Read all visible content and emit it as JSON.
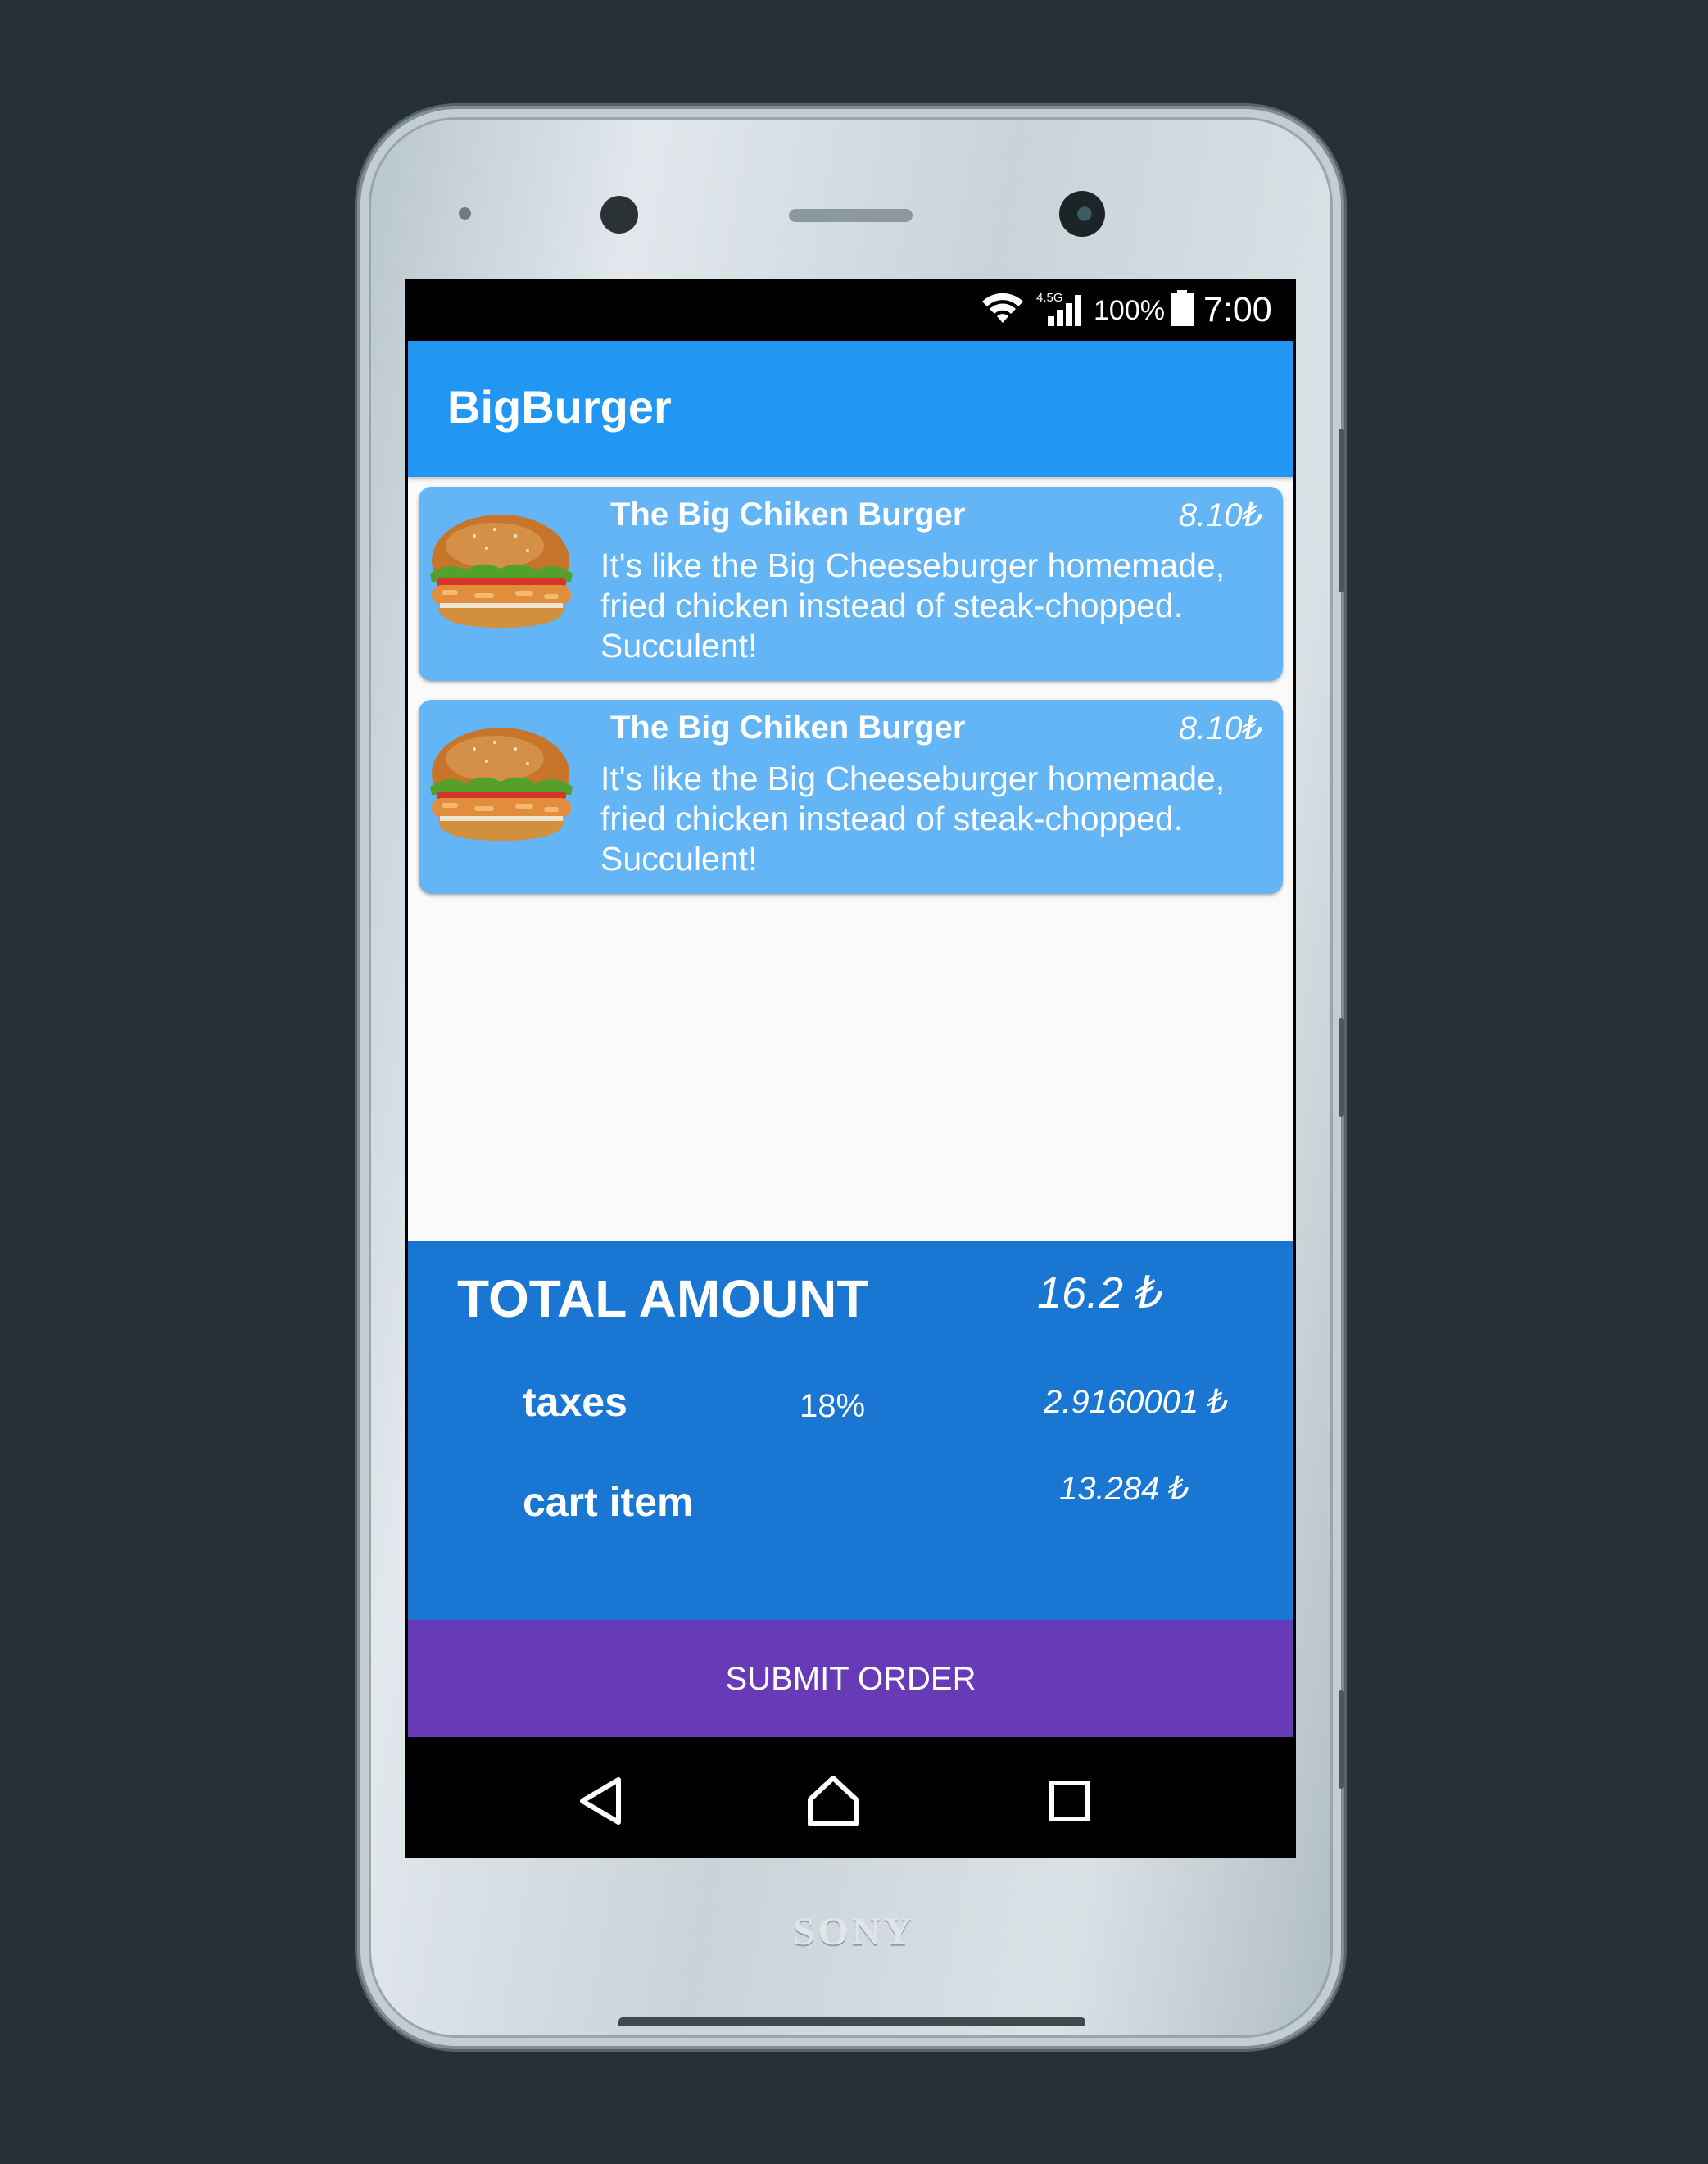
{
  "device": {
    "brand": "SONY"
  },
  "status_bar": {
    "network": "4.5G",
    "battery_percent": "100%",
    "time": "7:00"
  },
  "app_bar": {
    "title": "BigBurger"
  },
  "cart_items": [
    {
      "title": "The Big Chiken Burger",
      "price": "8.10₺",
      "description": "It's like the Big Cheeseburger homemade, fried chicken instead of steak-chopped. Succulent!"
    },
    {
      "title": "The Big Chiken Burger",
      "price": "8.10₺",
      "description": "It's like the Big Cheeseburger homemade, fried chicken instead of steak-chopped. Succulent!"
    }
  ],
  "summary": {
    "total_label": "TOTAL AMOUNT",
    "total_value": "16.2 ₺",
    "taxes_label": "taxes",
    "taxes_rate": "18%",
    "taxes_value": "2.9160001 ₺",
    "cart_label": "cart item",
    "cart_value": "13.284 ₺"
  },
  "submit_button": {
    "label": "SUBMIT ORDER"
  },
  "colors": {
    "background": "#263136",
    "app_bar": "#2196f3",
    "card": "#64b5f6",
    "summary": "#1976d2",
    "submit": "#673ab7"
  },
  "icons": [
    "wifi-icon",
    "signal-icon",
    "battery-icon",
    "back-icon",
    "home-icon",
    "recents-icon",
    "burger-image"
  ]
}
